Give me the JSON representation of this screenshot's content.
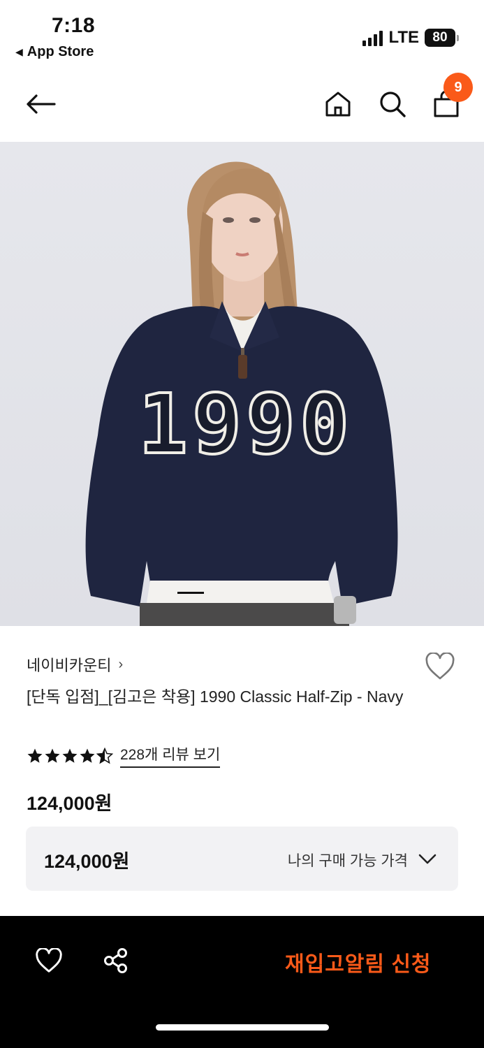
{
  "status_bar": {
    "time": "7:18",
    "back_app": "App Store",
    "back_icon": "triangle-left-icon",
    "network": "LTE",
    "battery": "80"
  },
  "header": {
    "cart_count": "9",
    "icons": [
      "back-arrow-icon",
      "home-icon",
      "search-icon",
      "shopping-bag-icon"
    ]
  },
  "product": {
    "brand": "네이비카운티",
    "brand_chevron": "›",
    "title": "[단독 입점]_[김고은 착용] 1990 Classic Half-Zip - Navy",
    "rating": 4.5,
    "review_link": "228개 리뷰 보기",
    "price": "124,000원",
    "image_print": "1990"
  },
  "price_box": {
    "value": "124,000원",
    "label": "나의 구매 가능 가격"
  },
  "bottom_bar": {
    "cta": "재입고알림 신청"
  },
  "colors": {
    "accent": "#fa5a19",
    "bottom_bar_bg": "#000000",
    "price_box_bg": "#f2f2f4"
  }
}
